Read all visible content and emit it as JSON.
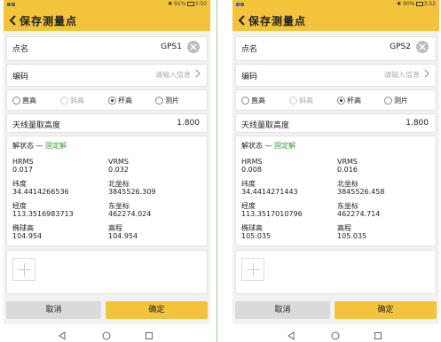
{
  "screens": [
    {
      "status_time": "3:50",
      "status_battery": "91%",
      "title": "保存测量点",
      "point_name_label": "点名",
      "point_name_value": "GPS1",
      "code_label": "编码",
      "code_placeholder": "请输入信息",
      "modes": [
        "直高",
        "斜高",
        "杆高",
        "测片"
      ],
      "selected_mode": "杆高",
      "antenna_label": "天线量取高度",
      "antenna_value": "1.800",
      "solution_label": "解状态 — ",
      "solution_value": "固定解",
      "fields": [
        {
          "label": "HRMS",
          "value": "0.017"
        },
        {
          "label": "VRMS",
          "value": "0.032"
        },
        {
          "label": "纬度",
          "value": "34.4414266536"
        },
        {
          "label": "北坐标",
          "value": "3845526.309"
        },
        {
          "label": "经度",
          "value": "113.3516983713"
        },
        {
          "label": "东坐标",
          "value": "462274.024"
        },
        {
          "label": "椭球高",
          "value": "104.954"
        },
        {
          "label": "高程",
          "value": "104.954"
        }
      ],
      "cancel_label": "取消",
      "confirm_label": "确定"
    },
    {
      "status_time": "3:52",
      "status_battery": "90%",
      "title": "保存测量点",
      "point_name_label": "点名",
      "point_name_value": "GPS2",
      "code_label": "编码",
      "code_placeholder": "请输入信息",
      "modes": [
        "直高",
        "斜高",
        "杆高",
        "测片"
      ],
      "selected_mode": "杆高",
      "antenna_label": "天线量取高度",
      "antenna_value": "1.800",
      "solution_label": "解状态 — ",
      "solution_value": "固定解",
      "fields": [
        {
          "label": "HRMS",
          "value": "0.008"
        },
        {
          "label": "VRMS",
          "value": "0.016"
        },
        {
          "label": "纬度",
          "value": "34.4414271443"
        },
        {
          "label": "北坐标",
          "value": "3845526.458"
        },
        {
          "label": "经度",
          "value": "113.3517010796"
        },
        {
          "label": "东坐标",
          "value": "462274.714"
        },
        {
          "label": "椭球高",
          "value": "105.035"
        },
        {
          "label": "高程",
          "value": "105.035"
        }
      ],
      "cancel_label": "取消",
      "confirm_label": "确定"
    }
  ],
  "colors": {
    "accent": "#f3c43b",
    "fixed_solution": "#3a9a3a",
    "background": "#f2f2f2",
    "cancel_button": "#dadada"
  },
  "icons": [
    "back-arrow-icon",
    "clear-icon",
    "chevron-right-icon",
    "add-photo-icon",
    "nav-back-icon",
    "nav-home-icon",
    "nav-recents-icon"
  ]
}
